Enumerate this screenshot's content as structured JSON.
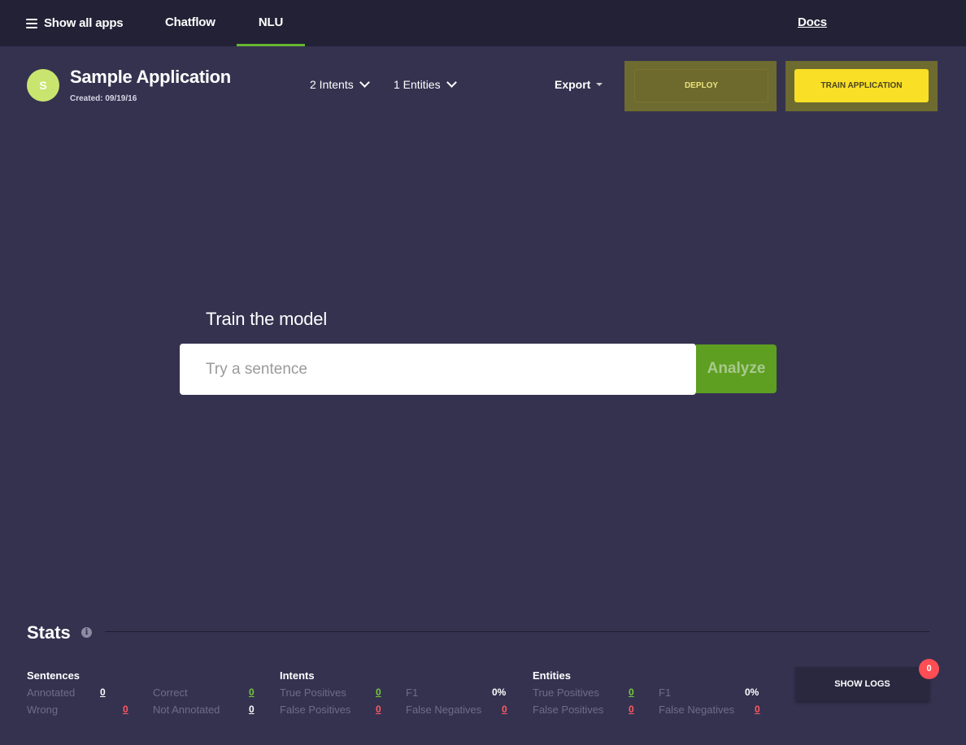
{
  "topnav": {
    "menu_label": "Show all apps",
    "tabs": [
      {
        "label": "Chatflow",
        "active": false
      },
      {
        "label": "NLU",
        "active": true
      }
    ],
    "docs_label": "Docs",
    "active_accent": "#66b630"
  },
  "app": {
    "avatar_letter": "S",
    "avatar_color": "#c9e56f",
    "name": "Sample Application",
    "created": "Created: 09/19/16",
    "intents_dropdown": "2 Intents",
    "entities_dropdown": "1 Entities",
    "export_label": "Export",
    "deploy_label": "DEPLOY",
    "train_label": "TRAIN APPLICATION",
    "train_color": "#f9df25"
  },
  "train": {
    "title": "Train the model",
    "input_placeholder": "Try a sentence",
    "input_value": "",
    "analyze_label": "Analyze",
    "analyze_color": "#5e9f22"
  },
  "stats": {
    "title": "Stats",
    "info_icon": "info-icon",
    "sentences": {
      "title": "Sentences",
      "annotated_label": "Annotated",
      "annotated_value": "0",
      "correct_label": "Correct",
      "correct_value": "0",
      "wrong_label": "Wrong",
      "wrong_value": "0",
      "not_annotated_label": "Not Annotated",
      "not_annotated_value": "0"
    },
    "intents": {
      "title": "Intents",
      "true_positives_label": "True Positives",
      "true_positives_value": "0",
      "f1_label": "F1",
      "f1_value": "0%",
      "false_positives_label": "False Positives",
      "false_positives_value": "0",
      "false_negatives_label": "False Negatives",
      "false_negatives_value": "0"
    },
    "entities": {
      "title": "Entities",
      "true_positives_label": "True Positives",
      "true_positives_value": "0",
      "f1_label": "F1",
      "f1_value": "0%",
      "false_positives_label": "False Positives",
      "false_positives_value": "0",
      "false_negatives_label": "False Negatives",
      "false_negatives_value": "0"
    },
    "show_logs_label": "SHOW LOGS",
    "logs_badge": "0",
    "colors": {
      "positive": "#76c83a",
      "negative": "#ff5a5f"
    }
  }
}
